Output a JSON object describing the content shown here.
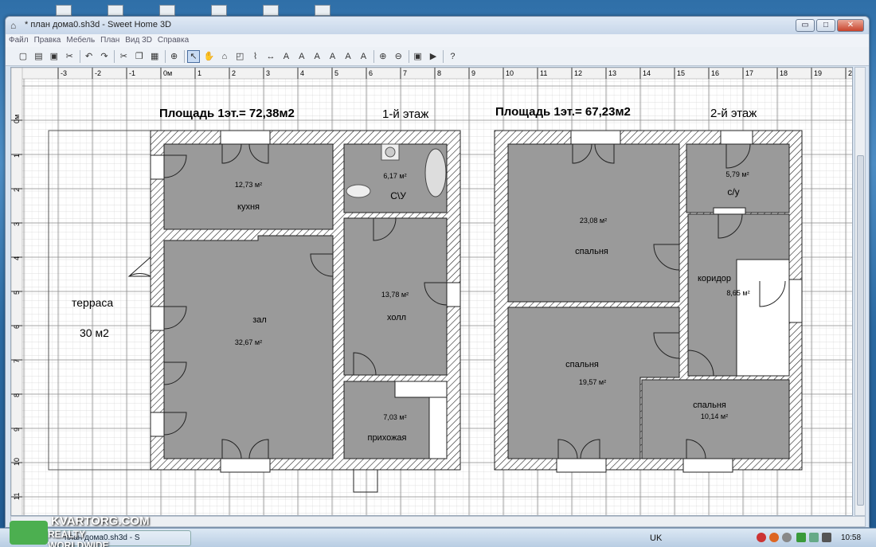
{
  "window": {
    "title": "* план дома0.sh3d - Sweet Home 3D",
    "minimize": "▭",
    "maximize": "□",
    "close": "✕"
  },
  "menu": {
    "items": [
      "Файл",
      "Правка",
      "Мебель",
      "План",
      "Вид 3D",
      "Справка"
    ]
  },
  "toolbar": {
    "icons": [
      "new-file-icon",
      "open-icon",
      "save-icon",
      "cut-preferences-icon",
      "undo-icon",
      "redo-icon",
      "cut-icon",
      "copy-icon",
      "paste-icon",
      "add-furniture-icon",
      "select-icon",
      "pan-icon",
      "create-walls-icon",
      "create-rooms-icon",
      "create-polylines-icon",
      "create-dimensions-icon",
      "add-text-icon",
      "text-style-icon",
      "text-bold-icon",
      "text-italic-icon",
      "increase-text-icon",
      "decrease-text-icon",
      "zoom-in-icon",
      "zoom-out-icon",
      "create-photo-icon",
      "create-video-icon",
      "help-icon"
    ]
  },
  "ruler": {
    "h_ticks": [
      "-3",
      "-2",
      "-1",
      "0м",
      "1",
      "2",
      "3",
      "4",
      "5",
      "6",
      "7",
      "8",
      "9",
      "10",
      "11",
      "12",
      "13",
      "14",
      "15",
      "16",
      "17",
      "18",
      "19",
      "2"
    ],
    "v_ticks": [
      "0м",
      "1",
      "2",
      "3",
      "4",
      "5",
      "6",
      "7",
      "8",
      "9",
      "10",
      "11"
    ]
  },
  "plan": {
    "floor1_area": "Площадь 1эт.= 72,38м2",
    "floor1_label": "1-й этаж",
    "floor2_area": "Площадь 1эт.= 67,23м2",
    "floor2_label": "2-й этаж",
    "terrace_name": "терраса",
    "terrace_area": "30 м2",
    "rooms1": [
      {
        "name": "кухня",
        "area": "12,73 м²"
      },
      {
        "name": "С\\У",
        "area": "6,17 м²"
      },
      {
        "name": "зал",
        "area": "32,67 м²"
      },
      {
        "name": "холл",
        "area": "13,78 м²"
      },
      {
        "name": "прихожая",
        "area": "7,03 м²"
      }
    ],
    "rooms2": [
      {
        "name": "спальня",
        "area": "23,08 м²"
      },
      {
        "name": "с/у",
        "area": "5,79 м²"
      },
      {
        "name": "коридор",
        "area": "8,65 м²"
      },
      {
        "name": "спальня",
        "area": "19,57 м²"
      },
      {
        "name": "спальня",
        "area": "10,14 м²"
      }
    ]
  },
  "taskbar": {
    "task_label": "план дома0.sh3d - S",
    "lang": "UK",
    "clock": "10:58"
  },
  "watermark": {
    "line1": "KVARTORG.COM",
    "line2": "REALTY WORLDWIDE"
  }
}
